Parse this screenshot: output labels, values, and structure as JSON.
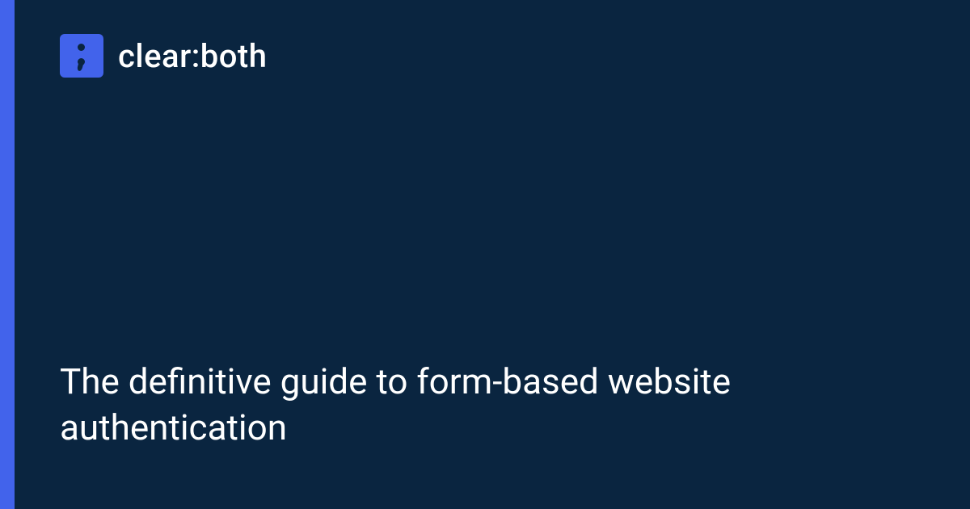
{
  "brand": {
    "name": "clear:both"
  },
  "article": {
    "title": "The definitive guide to form-based website authentication"
  },
  "colors": {
    "background": "#0a2540",
    "accent": "#4263eb",
    "text": "#ffffff"
  }
}
